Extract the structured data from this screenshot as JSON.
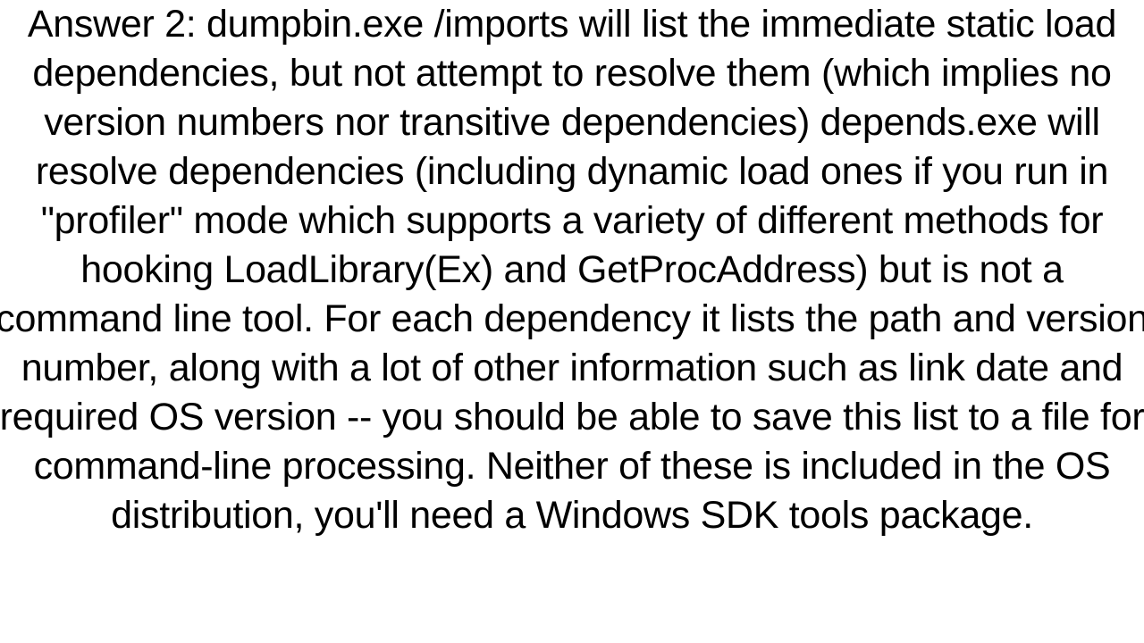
{
  "answer": {
    "text": "Answer 2: dumpbin.exe /imports will list the immediate static load dependencies, but not attempt to resolve them (which implies no version numbers nor transitive dependencies) depends.exe will resolve dependencies (including dynamic load ones if you run in \"profiler\" mode which supports a variety of different methods for hooking LoadLibrary(Ex) and GetProcAddress) but is not a command line tool.  For each dependency it lists the path and version number, along with a lot of other information such as link date and required OS version -- you should be able to save this list to a file for command-line processing. Neither of these is included in the OS distribution, you'll need a Windows SDK tools package."
  }
}
